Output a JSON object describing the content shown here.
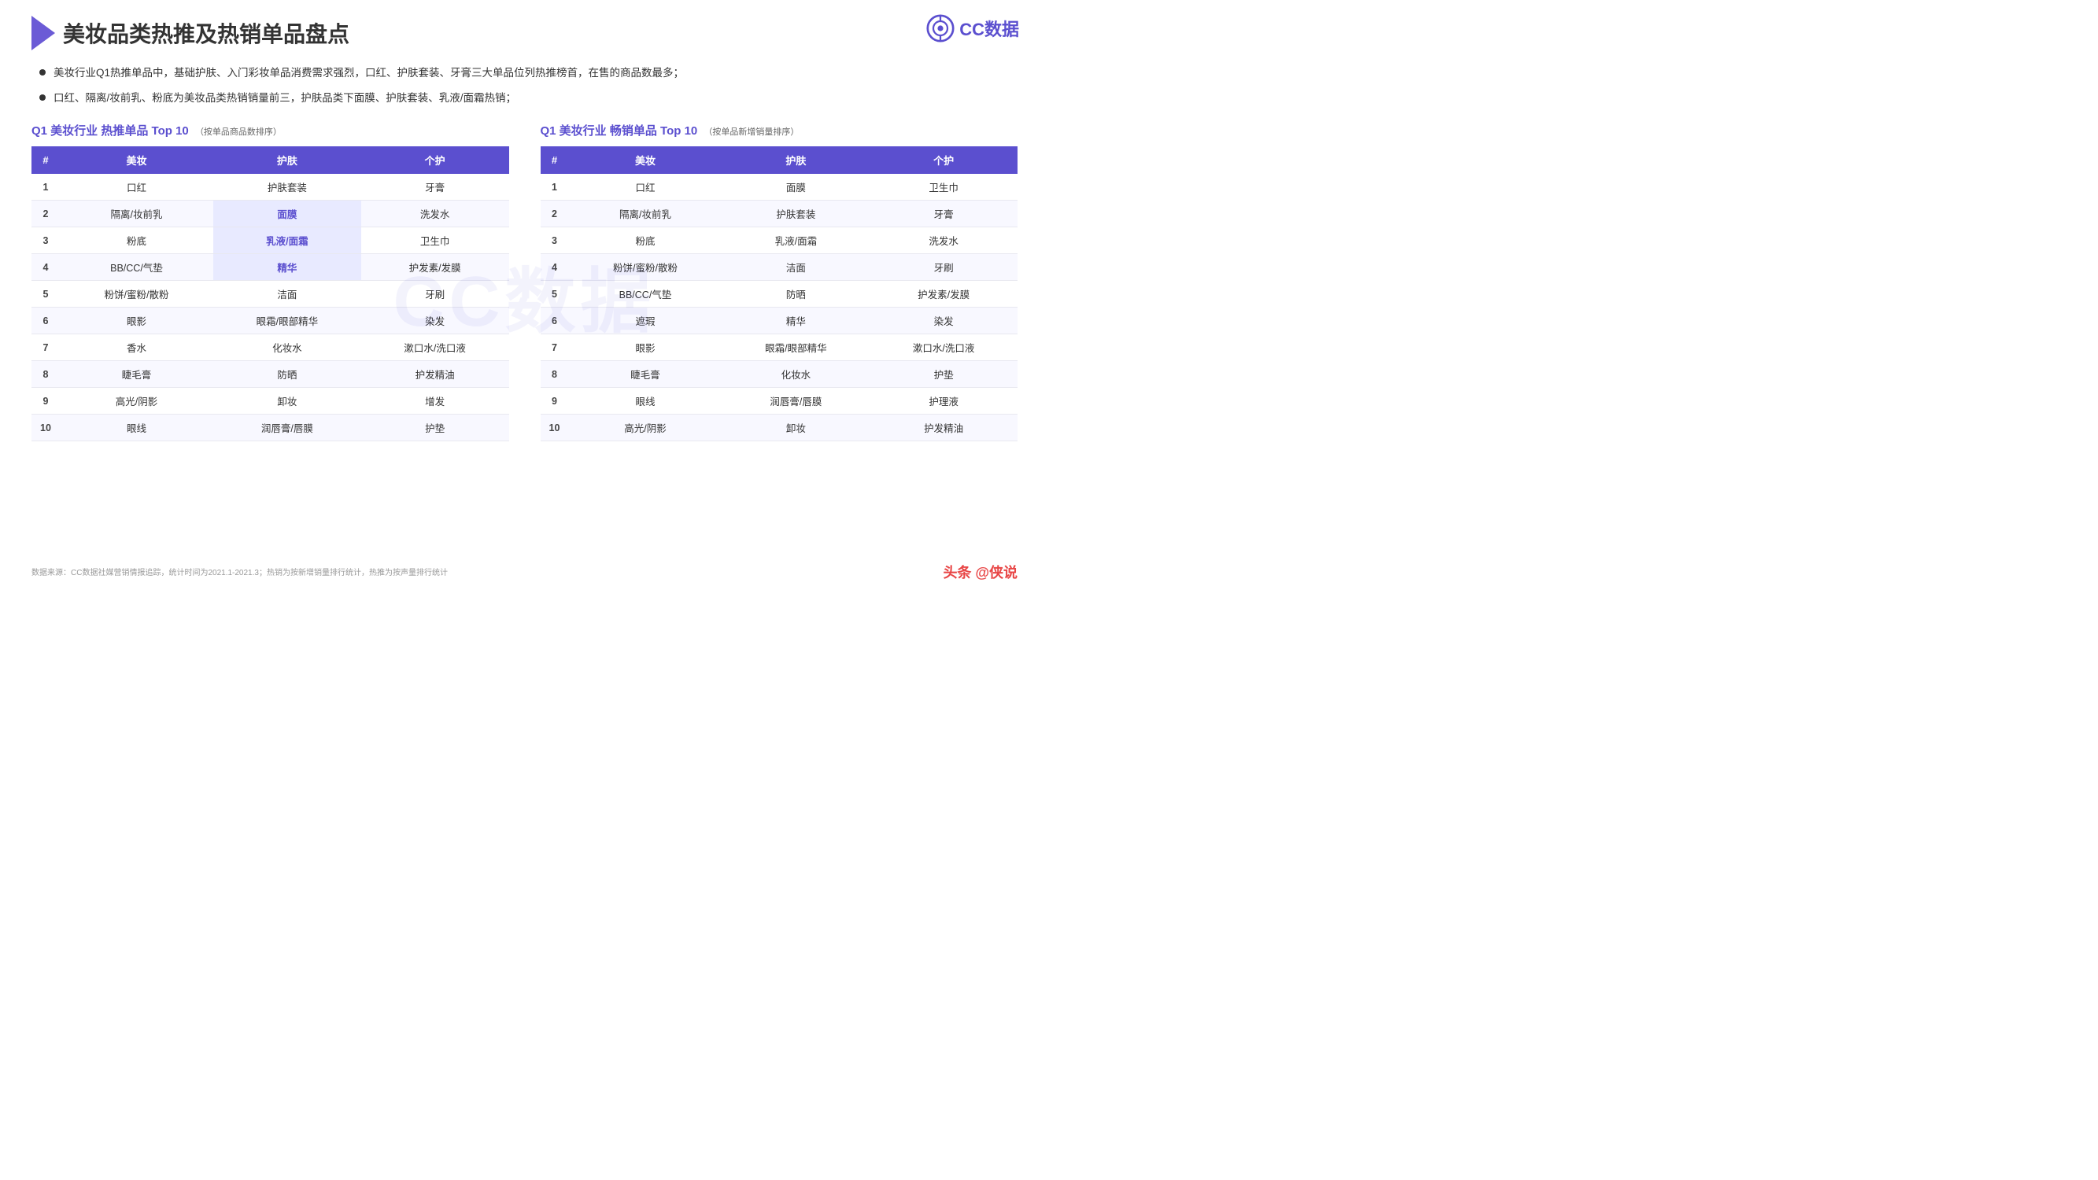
{
  "logo": {
    "text": "CC数据"
  },
  "header": {
    "title": "美妆品类热推及热销单品盘点"
  },
  "bullets": [
    "美妆行业Q1热推单品中，基础护肤、入门彩妆单品消费需求强烈，口红、护肤套装、牙膏三大单品位列热推榜首，在售的商品数最多；",
    "口红、隔离/妆前乳、粉底为美妆品类热销销量前三，护肤品类下面膜、护肤套装、乳液/面霜热销；"
  ],
  "table1": {
    "title_q1": "Q1 美妆行业 热推单品",
    "title_top": "Top 10",
    "title_note": "（按单品商品数排序）",
    "headers": [
      "#",
      "美妆",
      "护肤",
      "个护"
    ],
    "rows": [
      {
        "rank": "1",
        "col1": "口红",
        "col2": "护肤套装",
        "col3": "牙膏"
      },
      {
        "rank": "2",
        "col1": "隔离/妆前乳",
        "col2": "面膜",
        "col3": "洗发水",
        "highlight2": true
      },
      {
        "rank": "3",
        "col1": "粉底",
        "col2": "乳液/面霜",
        "col3": "卫生巾",
        "highlight2": true
      },
      {
        "rank": "4",
        "col1": "BB/CC/气垫",
        "col2": "精华",
        "col3": "护发素/发膜",
        "highlight2": true
      },
      {
        "rank": "5",
        "col1": "粉饼/蜜粉/散粉",
        "col2": "洁面",
        "col3": "牙刷"
      },
      {
        "rank": "6",
        "col1": "眼影",
        "col2": "眼霜/眼部精华",
        "col3": "染发"
      },
      {
        "rank": "7",
        "col1": "香水",
        "col2": "化妆水",
        "col3": "漱口水/洗口液"
      },
      {
        "rank": "8",
        "col1": "睫毛膏",
        "col2": "防晒",
        "col3": "护发精油"
      },
      {
        "rank": "9",
        "col1": "高光/阴影",
        "col2": "卸妆",
        "col3": "增发"
      },
      {
        "rank": "10",
        "col1": "眼线",
        "col2": "润唇膏/唇膜",
        "col3": "护垫"
      }
    ]
  },
  "table2": {
    "title_q1": "Q1 美妆行业 畅销单品",
    "title_top": "Top 10",
    "title_note": "（按单品新增销量排序）",
    "headers": [
      "#",
      "美妆",
      "护肤",
      "个护"
    ],
    "rows": [
      {
        "rank": "1",
        "col1": "口红",
        "col2": "面膜",
        "col3": "卫生巾"
      },
      {
        "rank": "2",
        "col1": "隔离/妆前乳",
        "col2": "护肤套装",
        "col3": "牙膏"
      },
      {
        "rank": "3",
        "col1": "粉底",
        "col2": "乳液/面霜",
        "col3": "洗发水"
      },
      {
        "rank": "4",
        "col1": "粉饼/蜜粉/散粉",
        "col2": "洁面",
        "col3": "牙刷"
      },
      {
        "rank": "5",
        "col1": "BB/CC/气垫",
        "col2": "防晒",
        "col3": "护发素/发膜"
      },
      {
        "rank": "6",
        "col1": "遮瑕",
        "col2": "精华",
        "col3": "染发"
      },
      {
        "rank": "7",
        "col1": "眼影",
        "col2": "眼霜/眼部精华",
        "col3": "漱口水/洗口液"
      },
      {
        "rank": "8",
        "col1": "睫毛膏",
        "col2": "化妆水",
        "col3": "护垫"
      },
      {
        "rank": "9",
        "col1": "眼线",
        "col2": "润唇膏/唇膜",
        "col3": "护理液"
      },
      {
        "rank": "10",
        "col1": "高光/阴影",
        "col2": "卸妆",
        "col3": "护发精油"
      }
    ]
  },
  "footer": {
    "source": "数据来源：CC数据社媒营销情报追踪，统计时间为2021.1-2021.3；热销为按新增销量排行统计，热推为按声量排行统计",
    "brand": "头条 @侠说"
  },
  "watermark": "CC数据"
}
